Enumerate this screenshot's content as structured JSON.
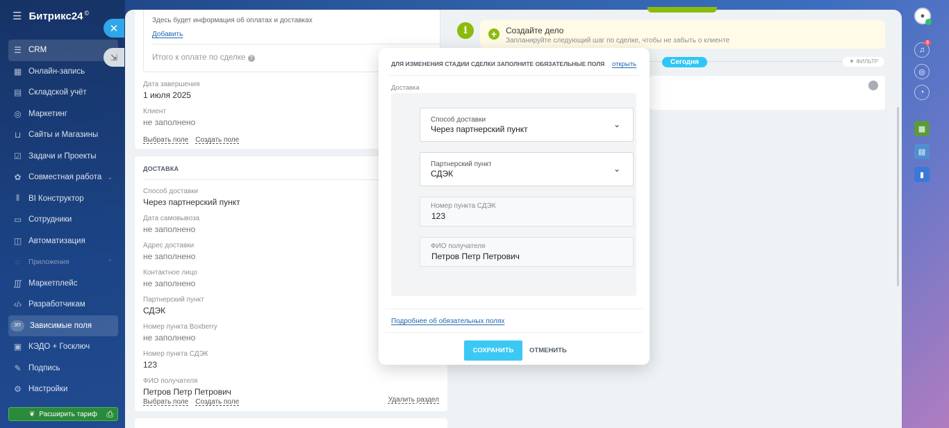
{
  "app": {
    "logo": "Битрикс24",
    "logo_mark": "©"
  },
  "sidebar": {
    "items": [
      {
        "label": "CRM",
        "icon": "filter-icon"
      },
      {
        "label": "Онлайн-запись",
        "icon": "calendar-icon"
      },
      {
        "label": "Складской учёт",
        "icon": "warehouse-icon"
      },
      {
        "label": "Маркетинг",
        "icon": "marketing-icon"
      },
      {
        "label": "Сайты и Магазины",
        "icon": "cart-icon"
      },
      {
        "label": "Задачи и Проекты",
        "icon": "checkbox-icon"
      },
      {
        "label": "Совместная работа",
        "icon": "collab-icon"
      },
      {
        "label": "BI Конструктор",
        "icon": "chart-icon"
      },
      {
        "label": "Сотрудники",
        "icon": "people-icon"
      },
      {
        "label": "Автоматизация",
        "icon": "robot-icon"
      },
      {
        "label": "Приложения",
        "icon": "apps-icon"
      },
      {
        "label": "Маркетплейс",
        "icon": "market-icon"
      },
      {
        "label": "Разработчикам",
        "icon": "code-icon"
      },
      {
        "label": "Зависимые поля",
        "icon": "badge-icon",
        "badge": "ЗП"
      },
      {
        "label": "КЭДО + Госключ",
        "icon": "doc-icon"
      },
      {
        "label": "Подпись",
        "icon": "pen-icon"
      },
      {
        "label": "Настройки",
        "icon": "gear-icon"
      }
    ],
    "upgrade_label": "Расширить тариф"
  },
  "left_column": {
    "payment_info": "Здесь будет информация об оплатах и доставках",
    "add_link": "Добавить",
    "total_label": "Итого к оплате по сделке",
    "close_date_label": "Дата завершения",
    "close_date_value": "1 июля 2025",
    "client_label": "Клиент",
    "client_value": "не заполнено",
    "select_field": "Выбрать поле",
    "create_field": "Создать поле",
    "delivery_section": {
      "title": "ДОСТАВКА",
      "fields": [
        {
          "label": "Способ доставки",
          "value": "Через партнерский пункт"
        },
        {
          "label": "Дата самовывоза",
          "value": "не заполнено"
        },
        {
          "label": "Адрес доставки",
          "value": "не заполнено"
        },
        {
          "label": "Контактное лицо",
          "value": "не заполнено"
        },
        {
          "label": "Партнерский пункт",
          "value": "СДЭК"
        },
        {
          "label": "Номер пункта Boxberry",
          "value": "не заполнено"
        },
        {
          "label": "Номер пункта СДЭК",
          "value": "123"
        },
        {
          "label": "ФИО получателя",
          "value": "Петров Петр Петрович"
        }
      ],
      "select_field": "Выбрать поле",
      "create_field": "Создать поле",
      "delete_section": "Удалить раздел"
    }
  },
  "timeline": {
    "todo_title": "Создайте дело",
    "todo_subtitle": "Запланируйте следующий шаг по сделке, чтобы не забыть о клиенте",
    "today_label": "Сегодня",
    "filter_label": "ФИЛЬТР"
  },
  "modal": {
    "header": "ДЛЯ ИЗМЕНЕНИЯ СТАДИИ СДЕЛКИ ЗАПОЛНИТЕ ОБЯЗАТЕЛЬНЫЕ ПОЛЯ",
    "open_link": "открыть",
    "section_label": "Доставка",
    "fields": [
      {
        "label": "Способ доставки",
        "value": "Через партнерский пункт",
        "type": "select"
      },
      {
        "label": "Партнерский пункт",
        "value": "СДЭК",
        "type": "select"
      },
      {
        "label": "Номер пункта СДЭК",
        "value": "123",
        "type": "input"
      },
      {
        "label": "ФИО получателя",
        "value": "Петров Петр Петрович",
        "type": "input"
      }
    ],
    "more_link": "Подробнее об обязательных полях",
    "save_button": "СОХРАНИТЬ",
    "cancel_button": "ОТМЕНИТЬ"
  },
  "right_rail": {
    "notifications_count": "8"
  },
  "colors": {
    "accent": "#2fc6f6",
    "save": "#3bc8f5",
    "green": "#8dbb0c",
    "todo_bg": "#fffbe6"
  }
}
